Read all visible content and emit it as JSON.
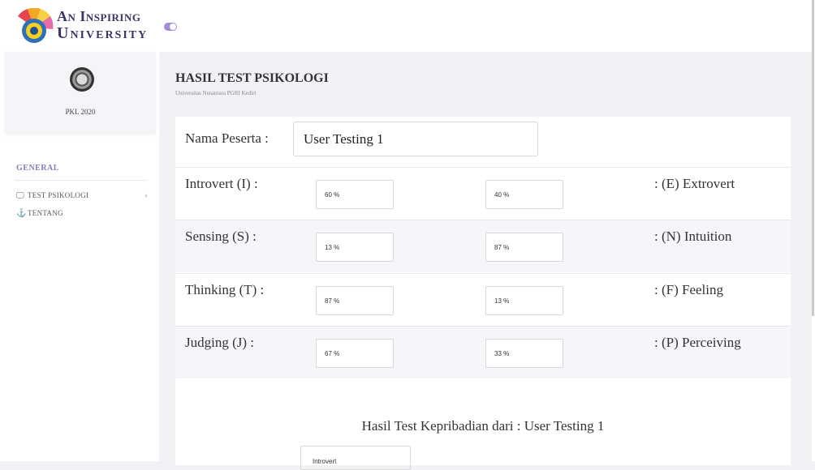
{
  "brand": {
    "line1": "An Inspiring",
    "line2": "University"
  },
  "sidebar": {
    "profile_name": "PKL 2020",
    "section_label": "GENERAL",
    "items": [
      {
        "label": "TEST PSIKOLOGI",
        "icon": "monitor-icon",
        "has_submenu": true
      },
      {
        "label": "TENTANG",
        "icon": "anchor-icon",
        "has_submenu": false
      }
    ]
  },
  "page": {
    "title": "HASIL TEST PSIKOLOGI",
    "subtitle": "Universitas Nusantara PGRI Kediri"
  },
  "participant": {
    "label": "Nama Peserta :",
    "value": "User Testing 1"
  },
  "dimensions": [
    {
      "left_label": "Introvert (I) :",
      "left_value": "60 %",
      "right_value": "40 %",
      "right_label": ": (E) Extrovert"
    },
    {
      "left_label": "Sensing (S) :",
      "left_value": "13 %",
      "right_value": "87 %",
      "right_label": ": (N) Intuition"
    },
    {
      "left_label": "Thinking (T) :",
      "left_value": "87 %",
      "right_value": "13 %",
      "right_label": ": (F) Feeling"
    },
    {
      "left_label": "Judging (J) :",
      "left_value": "67 %",
      "right_value": "33 %",
      "right_label": ": (P) Perceiving"
    }
  ],
  "result": {
    "title": "Hasil Test Kepribadian dari : User Testing 1",
    "first_value": "Introvert"
  },
  "colors": {
    "accent": "#a58ad6",
    "brand_text": "#3b3466",
    "background": "#f1f2f6"
  }
}
